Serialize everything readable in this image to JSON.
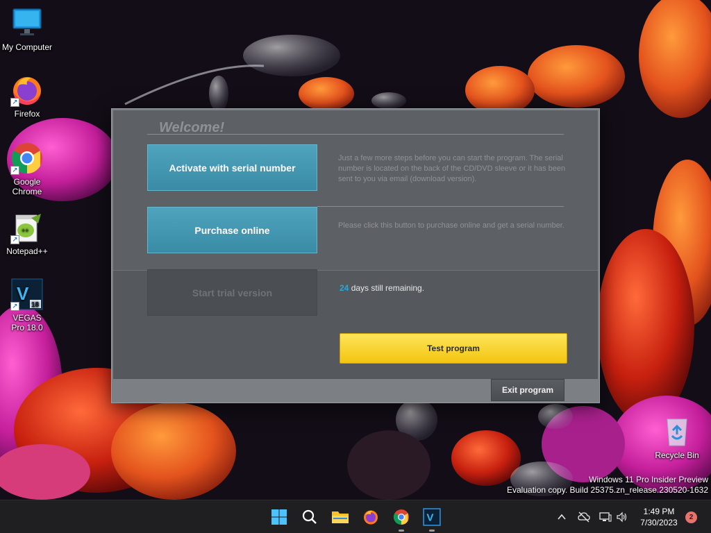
{
  "desktop": {
    "icons": [
      {
        "label": "My Computer",
        "icon": "monitor-icon"
      },
      {
        "label": "Firefox",
        "icon": "firefox-icon"
      },
      {
        "label": "Google Chrome",
        "icon": "chrome-icon"
      },
      {
        "label": "Notepad++",
        "icon": "notepadpp-icon"
      },
      {
        "label": "VEGAS Pro 18.0",
        "icon": "vegas-icon"
      },
      {
        "label": "Recycle Bin",
        "icon": "recycle-bin-icon"
      }
    ],
    "vegas_badge": "18"
  },
  "dialog": {
    "welcome": "Welcome!",
    "activate_label": "Activate with serial number",
    "activate_desc": "Just a few more steps before you can start the program. The serial number is located on the back of the CD/DVD sleeve or it has been sent to you via email (download version).",
    "purchase_label": "Purchase online",
    "purchase_desc": "Please click this button to purchase online and get a serial number.",
    "trial_label": "Start trial version",
    "days_number": "24",
    "days_text": " days still remaining.",
    "test_label": "Test program",
    "exit_label": "Exit program"
  },
  "watermark": {
    "line1": "Windows 11 Pro Insider Preview",
    "line2": "Evaluation copy. Build 25375.zn_release.230520-1632"
  },
  "taskbar": {
    "apps": [
      "start-icon",
      "search-icon",
      "file-explorer-icon",
      "firefox-icon",
      "chrome-icon",
      "vegas-icon"
    ],
    "time": "1:49 PM",
    "date": "7/30/2023",
    "notification_count": "2"
  },
  "colors": {
    "accent_blue": "#3f95b0",
    "test_button": "#f7d22e",
    "days_number": "#29a7d9"
  }
}
